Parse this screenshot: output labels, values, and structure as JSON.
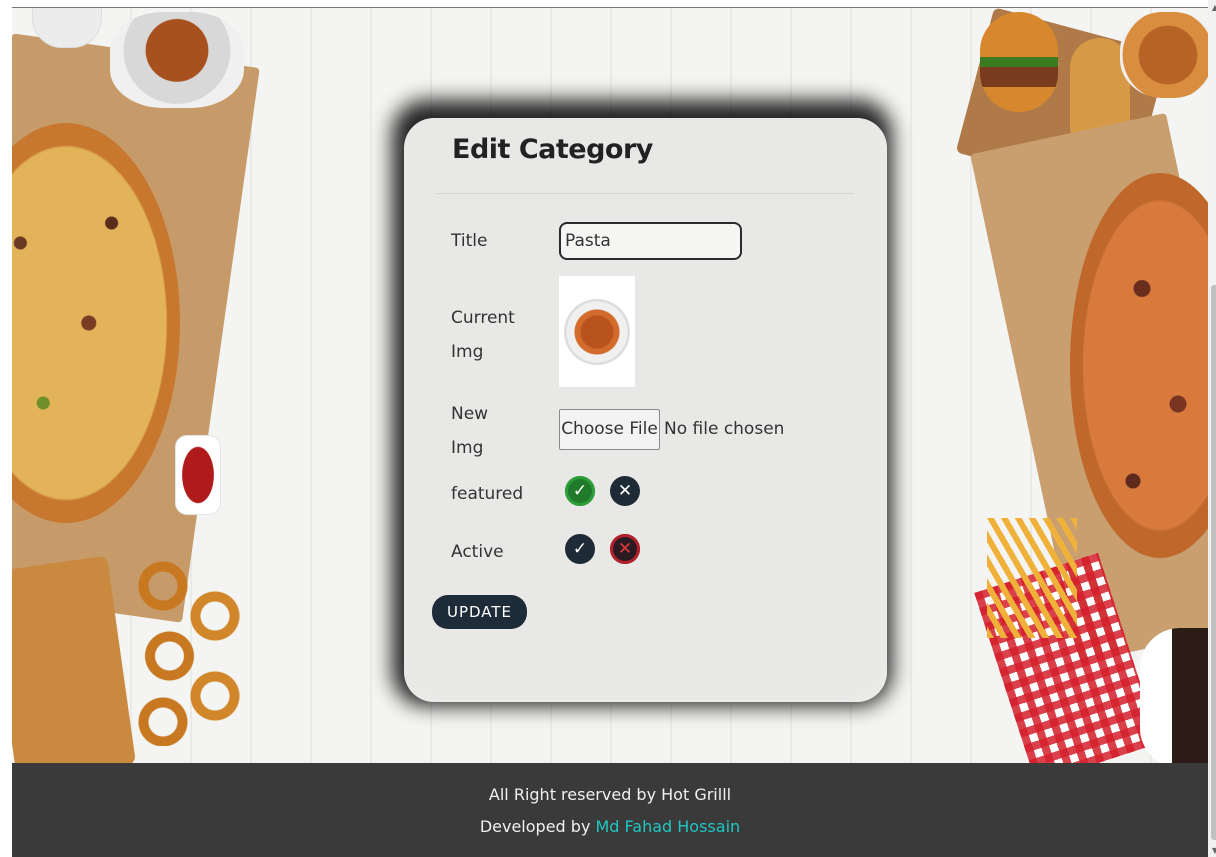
{
  "form": {
    "heading": "Edit Category",
    "title_label": "Title",
    "title_value": "Pasta",
    "current_img_label_line1": "Current",
    "current_img_label_line2": "Img",
    "new_img_label_line1": "New",
    "new_img_label_line2": "Img",
    "file_button_label": "Choose File",
    "file_status": "No file chosen",
    "featured_label": "featured",
    "featured_yes_symbol": "✓",
    "featured_no_symbol": "✕",
    "featured_selected": "yes",
    "active_label": "Active",
    "active_yes_symbol": "✓",
    "active_no_symbol": "✕",
    "active_selected": "no",
    "update_button_label": "UPDATE"
  },
  "footer": {
    "rights_text": "All Right reserved by Hot Grilll",
    "developed_prefix": "Developed by",
    "developer_name": "Md Fahad Hossain"
  },
  "colors": {
    "accent_dark": "#1e2b38",
    "selected_yes": "#2e9e3a",
    "selected_no": "#b51f2a",
    "footer_bg": "#3a3a3a",
    "footer_link": "#1fc7c3"
  },
  "scrollbar": {
    "up_arrow": "▲",
    "down_arrow": "▼"
  }
}
